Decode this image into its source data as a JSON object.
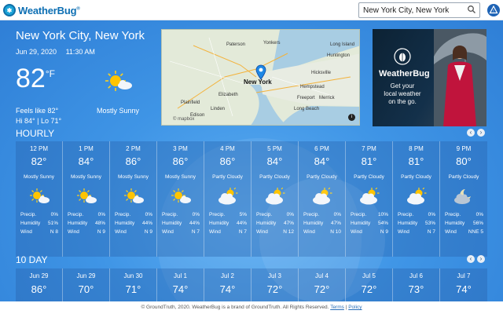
{
  "header": {
    "logo_text": "WeatherBug",
    "logo_mark": "®",
    "search_value": "New York City, New York"
  },
  "current": {
    "city": "New York City, New York",
    "date": "Jun 29, 2020",
    "time": "11:30 AM",
    "temp": "82",
    "unit": "°F",
    "feels_like": "Feels like 82°",
    "hi_lo": "Hi 84° | Lo 71°",
    "condition": "Mostly Sunny",
    "icon": "mostly-sunny-icon"
  },
  "map": {
    "labels": [
      "Paterson",
      "Yonkers",
      "Huntington",
      "Hicksville",
      "New York",
      "Elizabeth",
      "Plainfield",
      "Hempstead",
      "Merrick",
      "Freeport",
      "Edison",
      "Linden",
      "Long Beach",
      "Long Island"
    ],
    "attribution": "© mapbox"
  },
  "ad": {
    "brand": "WeatherBug",
    "tagline_1": "Get your",
    "tagline_2": "local weather",
    "tagline_3": "on the go."
  },
  "hourly": {
    "title": "HOURLY",
    "labels": {
      "precip": "Precip.",
      "humidity": "Humidity",
      "wind": "Wind"
    },
    "items": [
      {
        "time": "12 PM",
        "temp": "82°",
        "cond": "Mostly Sunny",
        "icon": "mostly-sunny-icon",
        "precip": "0%",
        "humidity": "51%",
        "wind": "N 8"
      },
      {
        "time": "1 PM",
        "temp": "84°",
        "cond": "Mostly Sunny",
        "icon": "mostly-sunny-icon",
        "precip": "0%",
        "humidity": "48%",
        "wind": "N 9"
      },
      {
        "time": "2 PM",
        "temp": "86°",
        "cond": "Mostly Sunny",
        "icon": "mostly-sunny-icon",
        "precip": "0%",
        "humidity": "44%",
        "wind": "N 9"
      },
      {
        "time": "3 PM",
        "temp": "86°",
        "cond": "Mostly Sunny",
        "icon": "mostly-sunny-icon",
        "precip": "0%",
        "humidity": "44%",
        "wind": "N 7"
      },
      {
        "time": "4 PM",
        "temp": "86°",
        "cond": "Partly Cloudy",
        "icon": "partly-cloudy-icon",
        "precip": "5%",
        "humidity": "44%",
        "wind": "N 7"
      },
      {
        "time": "5 PM",
        "temp": "84°",
        "cond": "Partly Cloudy",
        "icon": "partly-cloudy-icon",
        "precip": "0%",
        "humidity": "47%",
        "wind": "N 12"
      },
      {
        "time": "6 PM",
        "temp": "84°",
        "cond": "Partly Cloudy",
        "icon": "partly-cloudy-icon",
        "precip": "0%",
        "humidity": "47%",
        "wind": "N 10"
      },
      {
        "time": "7 PM",
        "temp": "81°",
        "cond": "Partly Cloudy",
        "icon": "partly-cloudy-icon",
        "precip": "10%",
        "humidity": "54%",
        "wind": "N 9"
      },
      {
        "time": "8 PM",
        "temp": "81°",
        "cond": "Partly Cloudy",
        "icon": "partly-cloudy-icon",
        "precip": "0%",
        "humidity": "53%",
        "wind": "N 7"
      },
      {
        "time": "9 PM",
        "temp": "80°",
        "cond": "Partly Cloudy",
        "icon": "partly-cloudy-night-icon",
        "precip": "0%",
        "humidity": "56%",
        "wind": "NNE 5"
      }
    ]
  },
  "daily": {
    "title": "10 DAY",
    "items": [
      {
        "date": "Jun 29",
        "temp": "86°"
      },
      {
        "date": "Jun 29",
        "temp": "70°"
      },
      {
        "date": "Jun 30",
        "temp": "71°"
      },
      {
        "date": "Jul 1",
        "temp": "74°"
      },
      {
        "date": "Jul 2",
        "temp": "74°"
      },
      {
        "date": "Jul 3",
        "temp": "72°"
      },
      {
        "date": "Jul 4",
        "temp": "72°"
      },
      {
        "date": "Jul 5",
        "temp": "72°"
      },
      {
        "date": "Jul 6",
        "temp": "73°"
      },
      {
        "date": "Jul 7",
        "temp": "74°"
      }
    ]
  },
  "footer": {
    "text": "© GroundTruth, 2020. WeatherBug is a brand of GroundTruth. All Rights Reserved.",
    "terms": "Terms",
    "separator": "|",
    "policy": "Policy"
  },
  "nav": {
    "prev": "‹",
    "next": "›"
  },
  "colors": {
    "brand_blue": "#0d6fb3",
    "sky_blue": "#3f95e6"
  }
}
